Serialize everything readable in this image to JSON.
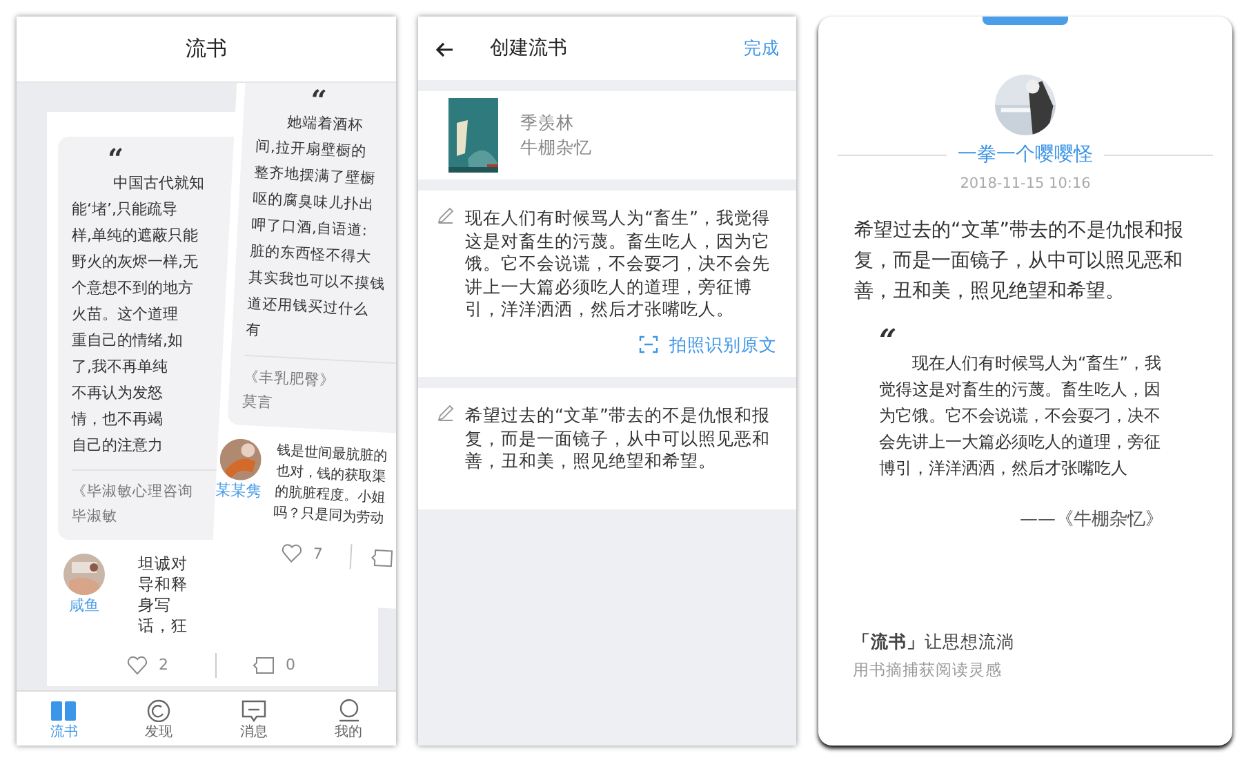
{
  "feed_screen": {
    "title": "流书",
    "cards": [
      {
        "quote_mark": "“",
        "quote_lines": [
          "中国古代就知",
          "能‘堵’,只能疏导",
          "样,单纯的遮蔽只能",
          "野火的灰烬一样,无",
          "个意想不到的地方",
          "火苗。这个道理",
          "重自己的情绪,如",
          "了,我不再单纯",
          "不再认为发怒",
          "情，也不再竭",
          "自己的注意力"
        ],
        "source": "《毕淑敏心理咨询",
        "author": "毕淑敏",
        "user": "咸鱼",
        "comment_lines": [
          "坦诚对",
          "导和释",
          "身写",
          "话，狂"
        ],
        "likes": "2",
        "comments": "0"
      },
      {
        "quote_mark": "“",
        "quote_lines": [
          "她端着酒杯",
          "间,拉开扇壁橱的",
          "整齐地摆满了壁橱",
          "呕的腐臭味儿扑出",
          "呷了口酒,自语道:",
          "脏的东西怪不得大",
          "其实我也可以不摸钱",
          "道还用钱买过什么",
          "有"
        ],
        "source": "《丰乳肥臀》",
        "author": "莫言",
        "user": "某某隽",
        "comment_lines": [
          "钱是世间最肮脏的",
          "也对，钱的获取渠",
          "的肮脏程度。小姐",
          "吗？只是同为劳动"
        ],
        "likes": "7"
      }
    ],
    "tabs": [
      {
        "label": "流书",
        "selected": true,
        "kind": "book"
      },
      {
        "label": "发现",
        "selected": false,
        "kind": "discover"
      },
      {
        "label": "消息",
        "selected": false,
        "kind": "message"
      },
      {
        "label": "我的",
        "selected": false,
        "kind": "me"
      }
    ]
  },
  "create_screen": {
    "title": "创建流书",
    "done": "完成",
    "book": {
      "author": "季羡林",
      "title": "牛棚杂忆"
    },
    "excerpts": [
      {
        "text": "现在人们有时候骂人为“畜生”，我觉得这是对畜生的污蔑。畜生吃人，因为它饿。它不会说谎，不会耍刁，决不会先讲上一大篇必须吃人的道理，旁征博引，洋洋洒洒，然后才张嘴吃人。",
        "action": "拍照识别原文"
      },
      {
        "text": "希望过去的“文革”带去的不是仇恨和报复，而是一面镜子，从中可以照见恶和善，丑和美，照见绝望和希望。"
      }
    ]
  },
  "share_screen": {
    "user": "一拳一个嘤嘤怪",
    "date": "2018-11-15 10:16",
    "text": "希望过去的“文革”带去的不是仇恨和报复，而是一面镜子，从中可以照见恶和善，丑和美，照见绝望和希望。",
    "quote_mark": "“",
    "quote": "现在人们有时候骂人为“畜生”，我觉得这是对畜生的污蔑。畜生吃人，因为它饿。它不会说谎，不会耍刁，决不会先讲上一大篇必须吃人的道理，旁征博引，洋洋洒洒，然后才张嘴吃人",
    "source": "——《牛棚杂忆》",
    "slogan": "**「流书」**让思想流淌",
    "subtitle": "用书摘捕获阅读灵感"
  }
}
